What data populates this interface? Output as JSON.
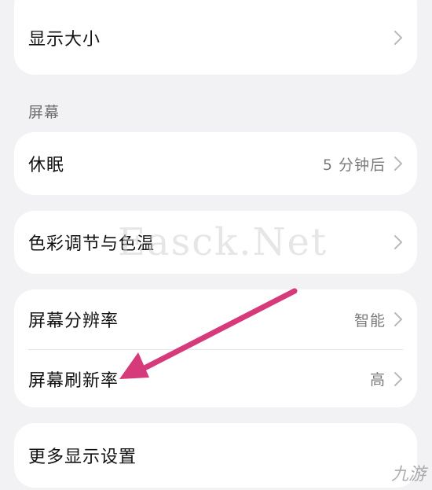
{
  "display_size": {
    "label": "显示大小"
  },
  "section": {
    "screen_header": "屏幕"
  },
  "sleep": {
    "label": "休眠",
    "value": "5 分钟后"
  },
  "color": {
    "label": "色彩调节与色温"
  },
  "resolution": {
    "label": "屏幕分辨率",
    "value": "智能"
  },
  "refresh_rate": {
    "label": "屏幕刷新率",
    "value": "高"
  },
  "more": {
    "label": "更多显示设置"
  },
  "watermark": {
    "text": "Easck.Net"
  },
  "logo": {
    "text": "九游"
  },
  "colors": {
    "arrow": "#d63a7a",
    "card": "#ffffff",
    "background": "#f2f2f4"
  }
}
